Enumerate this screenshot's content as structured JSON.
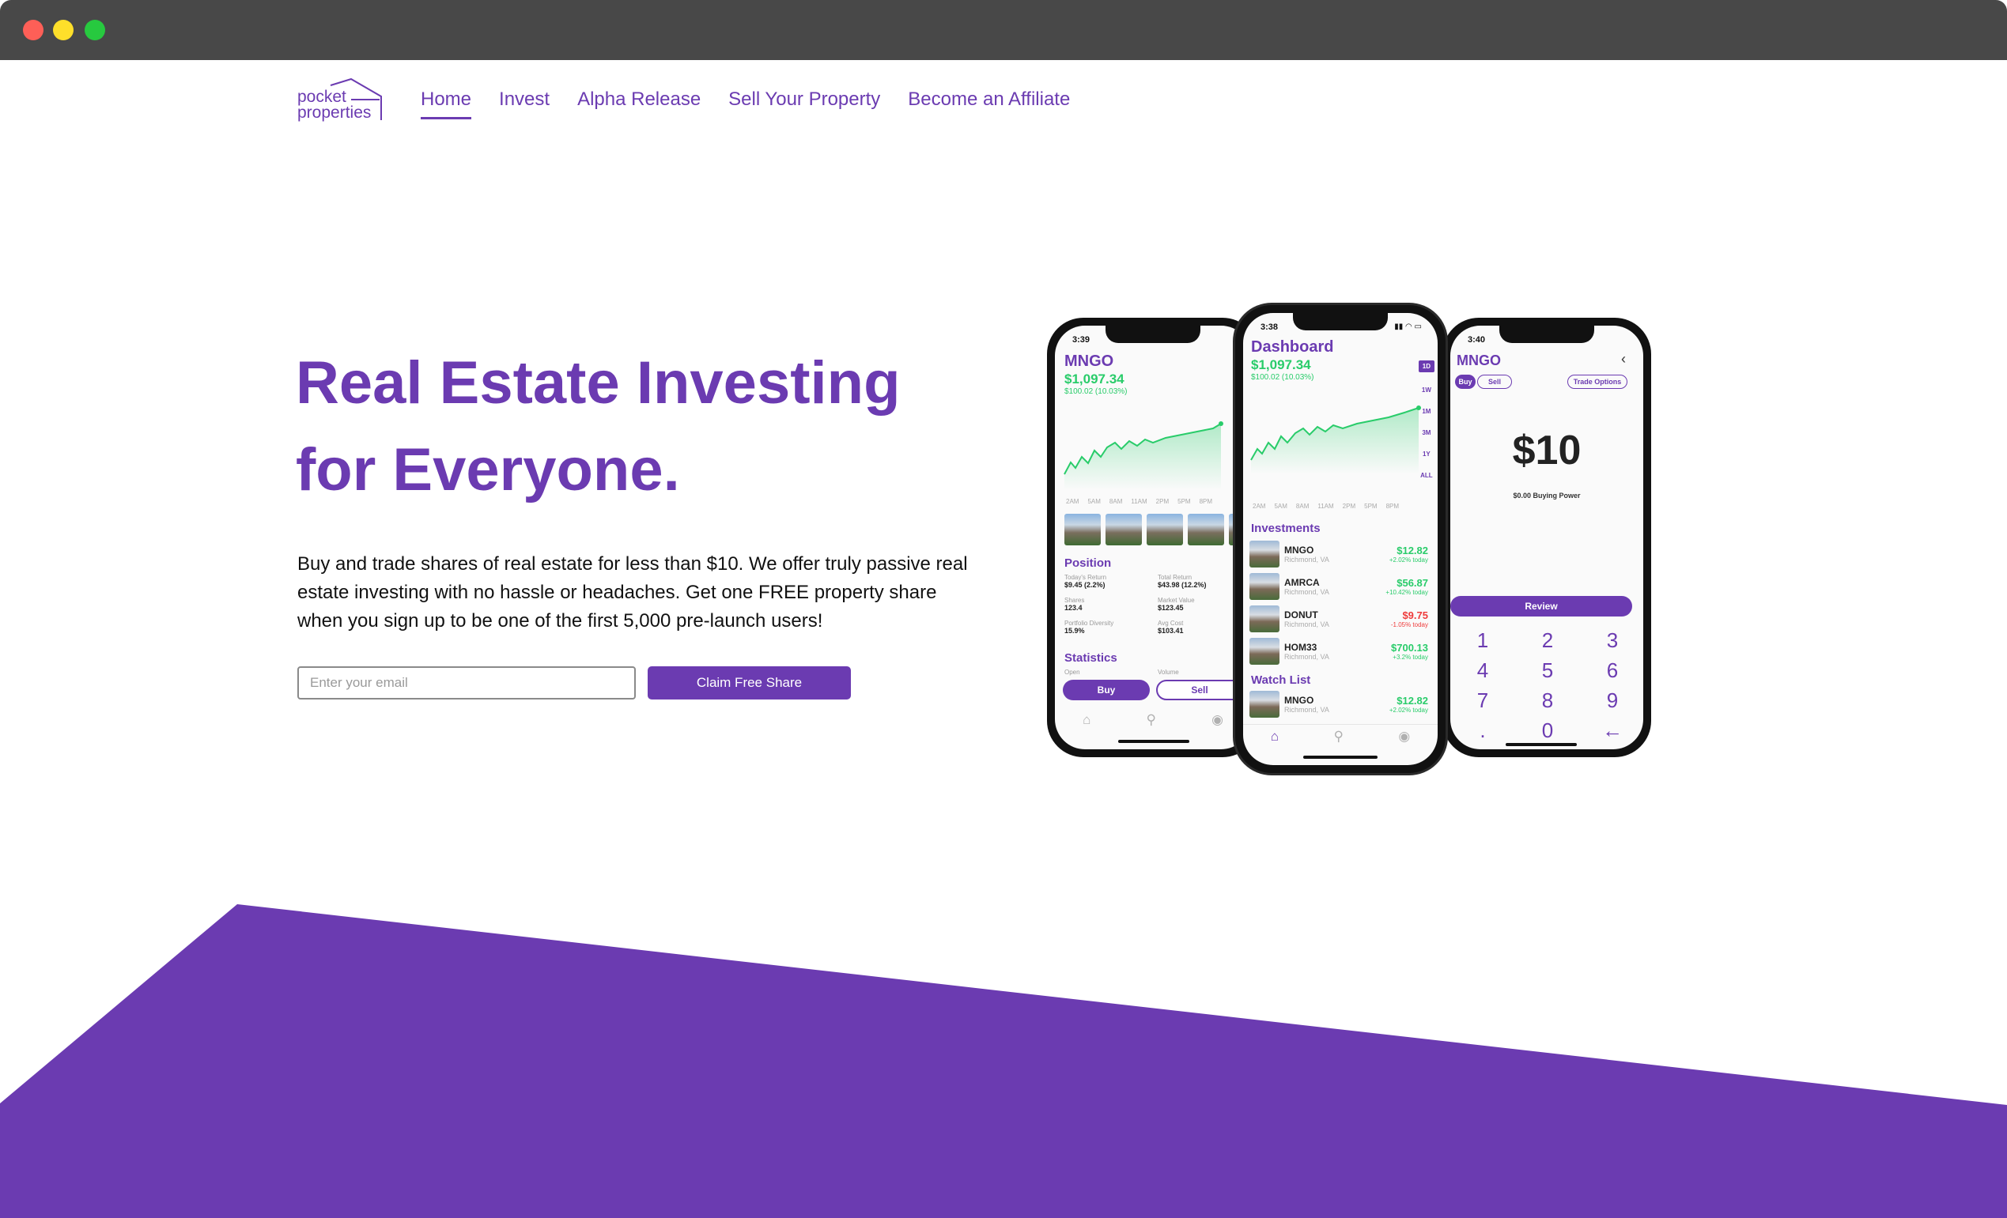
{
  "window": {
    "controls": [
      "close",
      "minimize",
      "maximize"
    ]
  },
  "brand": {
    "line1": "pocket",
    "line2": "properties",
    "color": "#6b3bb1"
  },
  "nav": {
    "items": [
      {
        "label": "Home",
        "active": true
      },
      {
        "label": "Invest"
      },
      {
        "label": "Alpha Release"
      },
      {
        "label": "Sell Your Property"
      },
      {
        "label": "Become an Affiliate"
      }
    ]
  },
  "hero": {
    "title_line1": "Real Estate Investing",
    "title_line2": "for Everyone.",
    "description": "Buy and trade shares of real estate for less than $10. We offer truly passive real estate investing with no hassle or headaches. Get one FREE property share when you sign up to be one of the first 5,000 pre-launch users!",
    "email_placeholder": "Enter your email",
    "cta_label": "Claim Free Share"
  },
  "phone_left": {
    "time": "3:39",
    "title": "MNGO",
    "price": "$1,097.34",
    "change": "$100.02 (10.03%)",
    "time_axis": [
      "2AM",
      "5AM",
      "8AM",
      "11AM",
      "2PM",
      "5PM",
      "8PM"
    ],
    "position_heading": "Position",
    "stats": [
      {
        "label": "Today's Return",
        "value": "$9.45 (2.2%)"
      },
      {
        "label": "Total Return",
        "value": "$43.98 (12.2%)"
      },
      {
        "label": "Shares",
        "value": "123.4"
      },
      {
        "label": "Market Value",
        "value": "$123.45"
      },
      {
        "label": "Portfolio Diversity",
        "value": "15.9%"
      },
      {
        "label": "Avg Cost",
        "value": "$103.41"
      }
    ],
    "statistics_heading": "Statistics",
    "stats2_left": "Open",
    "stats2_right": "Volume",
    "buy_label": "Buy",
    "sell_label": "Sell"
  },
  "phone_center": {
    "time": "3:38",
    "title": "Dashboard",
    "price": "$1,097.34",
    "change": "$100.02 (10.03%)",
    "ranges": [
      "1D",
      "1W",
      "1M",
      "3M",
      "1Y",
      "ALL"
    ],
    "time_axis": [
      "2AM",
      "5AM",
      "8AM",
      "11AM",
      "2PM",
      "5PM",
      "8PM"
    ],
    "investments_heading": "Investments",
    "investments": [
      {
        "name": "MNGO",
        "location": "Richmond, VA",
        "price": "$12.82",
        "change": "+2.02% today",
        "negative": false
      },
      {
        "name": "AMRCA",
        "location": "Richmond, VA",
        "price": "$56.87",
        "change": "+10.42% today",
        "negative": false
      },
      {
        "name": "DONUT",
        "location": "Richmond, VA",
        "price": "$9.75",
        "change": "-1.05% today",
        "negative": true
      },
      {
        "name": "HOM33",
        "location": "Richmond, VA",
        "price": "$700.13",
        "change": "+3.2% today",
        "negative": false
      }
    ],
    "watchlist_heading": "Watch List",
    "watchlist": [
      {
        "name": "MNGO",
        "location": "Richmond, VA",
        "price": "$12.82",
        "change": "+2.02% today",
        "negative": false
      }
    ]
  },
  "phone_right": {
    "time": "3:40",
    "title": "MNGO",
    "buy_label": "Buy",
    "sell_label": "Sell",
    "trade_options_label": "Trade Options",
    "amount": "$10",
    "buying_power": "$0.00 Buying Power",
    "review_label": "Review",
    "keys": [
      "1",
      "2",
      "3",
      "4",
      "5",
      "6",
      "7",
      "8",
      "9",
      ".",
      "0",
      "←"
    ]
  },
  "colors": {
    "accent": "#6b3bb1",
    "positive": "#29cc6a",
    "negative": "#ee3b3b",
    "chrome": "#484848"
  }
}
